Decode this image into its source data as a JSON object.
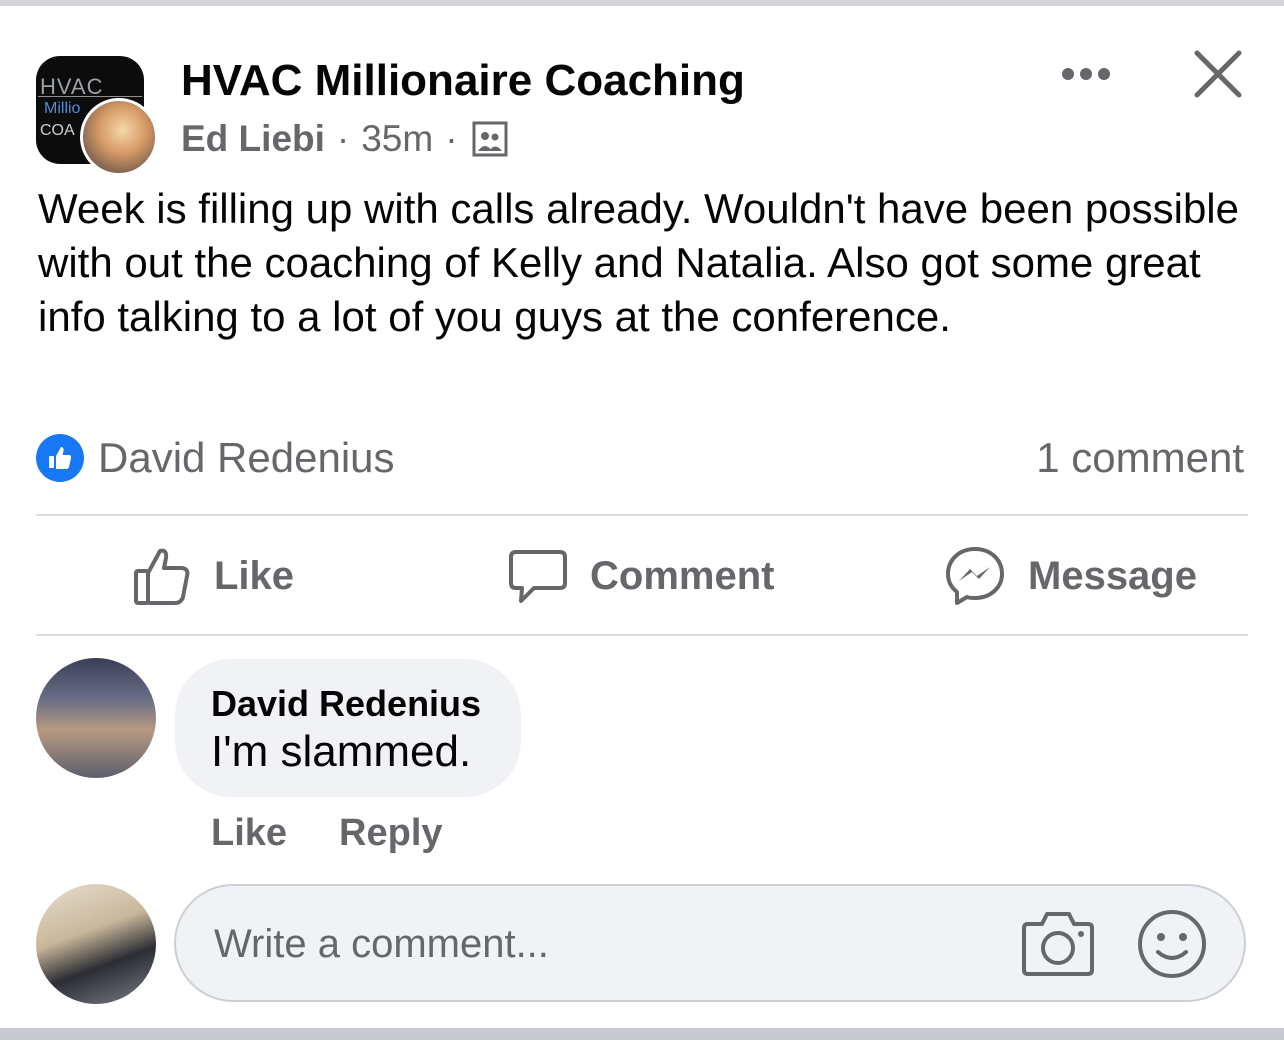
{
  "post": {
    "group_name": "HVAC Millionaire Coaching",
    "author": "Ed Liebi",
    "separator": "·",
    "time": "35m",
    "privacy_icon": "group-members-icon",
    "body": "Week is filling up with calls already. Wouldn't have been possible with out the coaching of Kelly and Natalia. Also got some great info talking to a lot of you guys at the conference.",
    "group_logo": {
      "line1": "HVAC",
      "line2": "Millio",
      "line3": "COA"
    }
  },
  "reactions": {
    "icon": "like-reaction-icon",
    "reactor": "David Redenius",
    "comment_count": "1 comment"
  },
  "actions": {
    "like": "Like",
    "comment": "Comment",
    "message": "Message"
  },
  "comments": [
    {
      "name": "David Redenius",
      "text": "I'm slammed.",
      "like": "Like",
      "reply": "Reply"
    }
  ],
  "composer": {
    "placeholder": "Write a comment...",
    "icons": [
      "camera-icon",
      "emoji-icon"
    ]
  },
  "colors": {
    "brand_blue": "#1877f2",
    "secondary_text": "#65676b",
    "bubble_bg": "#f0f2f5"
  }
}
